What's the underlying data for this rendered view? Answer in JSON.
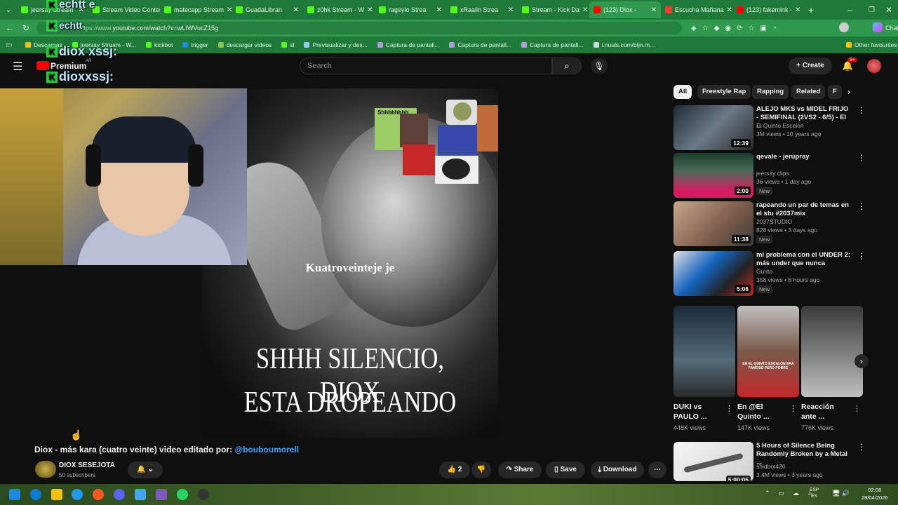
{
  "browser": {
    "tabs": [
      {
        "label": "jeersay Stream",
        "color": "#53fc18"
      },
      {
        "label": "Stream Video Content",
        "color": "#53fc18"
      },
      {
        "label": "matecapp Stream",
        "color": "#53fc18"
      },
      {
        "label": "GuadaLibran",
        "color": "#53fc18"
      },
      {
        "label": "z0hk Stream - W",
        "color": "#53fc18"
      },
      {
        "label": "rageylo Strea",
        "color": "#53fc18"
      },
      {
        "label": "xRaaiin Strea",
        "color": "#53fc18"
      },
      {
        "label": "Stream - Kick Da",
        "color": "#53fc18"
      },
      {
        "label": "(123) Diox -",
        "color": "#ff0000"
      },
      {
        "label": "Escucha Mañana",
        "color": "#ff3b30"
      },
      {
        "label": "(123) fakemink -",
        "color": "#ff0000"
      }
    ],
    "new_tab_icon": "plus-icon",
    "address": "youtube.com/watch?v=wLIWVucZ15g",
    "address_prefix": "https://www.",
    "profile_label": "Chat",
    "bookmarks": [
      {
        "label": "Descargas",
        "color": "#f4c20d"
      },
      {
        "label": "jeersay Stream - W...",
        "color": "#53fc18"
      },
      {
        "label": "kickbot",
        "color": "#53fc18"
      },
      {
        "label": "trigger",
        "color": "#1e88e5"
      },
      {
        "label": "descargar videos",
        "color": "#8bc34a"
      },
      {
        "label": "sl",
        "color": "#53fc18"
      },
      {
        "label": "Previsualizar y des...",
        "color": "#90caf9"
      },
      {
        "label": "Captura de pantall...",
        "color": "#b39ddb"
      },
      {
        "label": "Captura de pantall...",
        "color": "#b39ddb"
      },
      {
        "label": "Captura de pantall...",
        "color": "#b39ddb"
      },
      {
        "label": "i.nuuls.com/bIjn.m...",
        "color": "#cfd8dc"
      }
    ],
    "other_favourites": "Other favourites"
  },
  "stream_overlay": {
    "chat_user_1": "diox xssj:",
    "chat_user_2": "dioxxssj:",
    "chat_top": "echtt e",
    "chat_top_2": "echtt"
  },
  "youtube": {
    "brand": "Premium",
    "region": "AR",
    "search_placeholder": "Search",
    "create_label": "Create",
    "notif_count": "9+",
    "video": {
      "overlay_text_small": "Kuatroveinteje je",
      "overlay_line_1": "SHHH SILENCIO, DIOX",
      "overlay_line_2": "ESTA DROPEANDO",
      "collage_text": "Shhhhhhhh"
    },
    "title_prefix": "Diox - más kara (cuatro veinte) video editado por: ",
    "title_mention": "@bouboumorell",
    "channel_name": "DIOX SESEJOTA",
    "subscribers": "50 subscribers",
    "likes": "2",
    "share": "Share",
    "save": "Save",
    "download": "Download",
    "chips": [
      "All",
      "Freestyle Rap",
      "Rapping",
      "Related",
      "F"
    ],
    "recs": [
      {
        "title": "ALEJO MKS vs MIDEL FRIJO - SEMIFINAL (2VS2 - 6/5) - El ...",
        "channel": "El Quinto Escalón",
        "meta": "3M views • 10 years ago",
        "duration": "12:39",
        "new": ""
      },
      {
        "title": "qevale - jerupray",
        "channel": "jeersay clips",
        "meta": "36 views • 1 day ago",
        "duration": "2:00",
        "new": "New"
      },
      {
        "title": "rapeando un par de temas en el stu #2037mix",
        "channel": "2037STUDIO",
        "meta": "828 views • 3 days ago",
        "duration": "11:38",
        "new": "New"
      },
      {
        "title": "mi problema con el UNDER 2: más under que nunca",
        "channel": "Gurito",
        "meta": "358 views • 8 hours ago",
        "duration": "5:06",
        "new": "New"
      }
    ],
    "shorts": [
      {
        "title": "DUKI vs PAULO ...",
        "views": "448K views"
      },
      {
        "title": "En @El Quinto ...",
        "views": "147K views",
        "overlay": "EN EL QUINTO ESCALÓN ERA FAMOSO PERO POBRE"
      },
      {
        "title": "Reacción ante ...",
        "views": "776K views"
      }
    ],
    "last_rec": {
      "title": "5 Hours of Silence Being Randomly Broken by a Metal ...",
      "channel": "shidbot420",
      "meta": "3.4M views • 3 years ago",
      "duration": "5:00:05"
    }
  },
  "taskbar": {
    "lang": "ESP",
    "lang2": "ES",
    "time": "02:08",
    "date": "28/04/2026"
  }
}
